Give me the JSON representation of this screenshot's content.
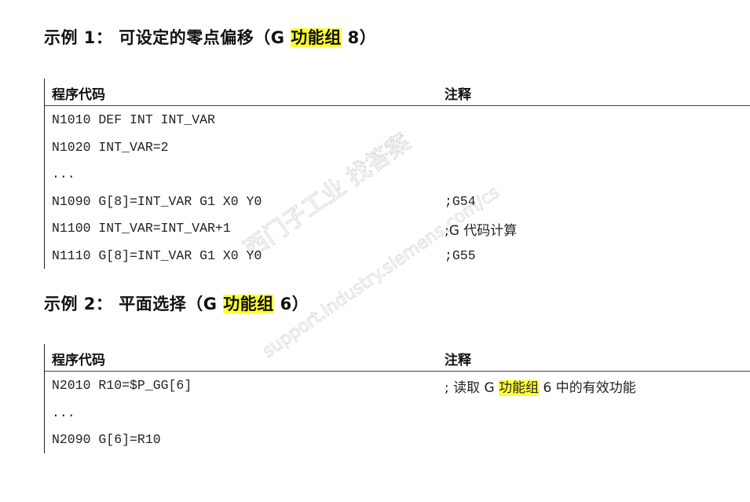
{
  "example1": {
    "title_prefix": "示例 1：  可设定的零点偏移（G ",
    "title_highlight": "功能组",
    "title_suffix": " 8）",
    "headers": {
      "code": "程序代码",
      "comment": "注释"
    },
    "rows": [
      {
        "code": "N1010 DEF INT INT_VAR",
        "comment": ""
      },
      {
        "code": "N1020 INT_VAR=2",
        "comment": ""
      },
      {
        "code": "...",
        "comment": ""
      },
      {
        "code": "N1090 G[8]=INT_VAR G1 X0 Y0",
        "comment": ";G54"
      },
      {
        "code": "N1100 INT_VAR=INT_VAR+1",
        "comment": ";G 代码计算"
      },
      {
        "code": "N1110 G[8]=INT_VAR G1 X0 Y0",
        "comment": ";G55"
      }
    ]
  },
  "example2": {
    "title_prefix": "示例 2：  平面选择（G ",
    "title_highlight": "功能组",
    "title_suffix": " 6）",
    "headers": {
      "code": "程序代码",
      "comment": "注释"
    },
    "rows": [
      {
        "code": "N2010 R10=$P_GG[6]",
        "comment_prefix": "; 读取 G ",
        "comment_highlight": "功能组",
        "comment_suffix": " 6 中的有效功能"
      },
      {
        "code": "...",
        "comment": ""
      },
      {
        "code": "N2090 G[6]=R10",
        "comment": ""
      }
    ]
  },
  "watermark": {
    "line1": "西门子工业  找答案",
    "line2": "support.industry.siemens.com/cs"
  },
  "colors": {
    "highlight": "#ffff33"
  }
}
